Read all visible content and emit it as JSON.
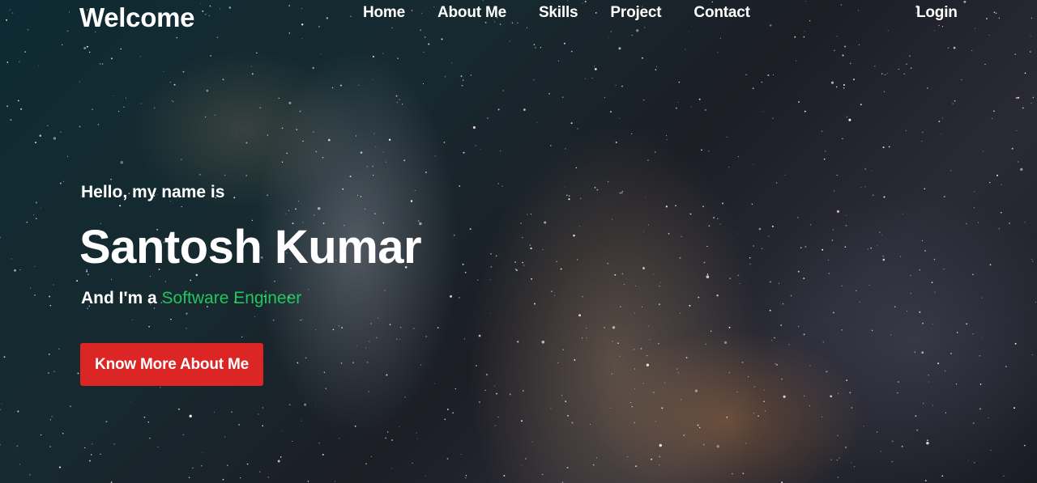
{
  "header": {
    "brand": "Welcome",
    "nav": [
      {
        "label": "Home"
      },
      {
        "label": "About Me"
      },
      {
        "label": "Skills"
      },
      {
        "label": "Project"
      },
      {
        "label": "Contact"
      }
    ],
    "login": "Login"
  },
  "hero": {
    "greeting": "Hello, my name is",
    "name": "Santosh Kumar",
    "role_prefix": "And I'm a",
    "role": "Software Engineer",
    "cta": "Know More About Me"
  },
  "colors": {
    "accent": "#22c55e",
    "button": "#dc2626",
    "text": "#ffffff"
  }
}
